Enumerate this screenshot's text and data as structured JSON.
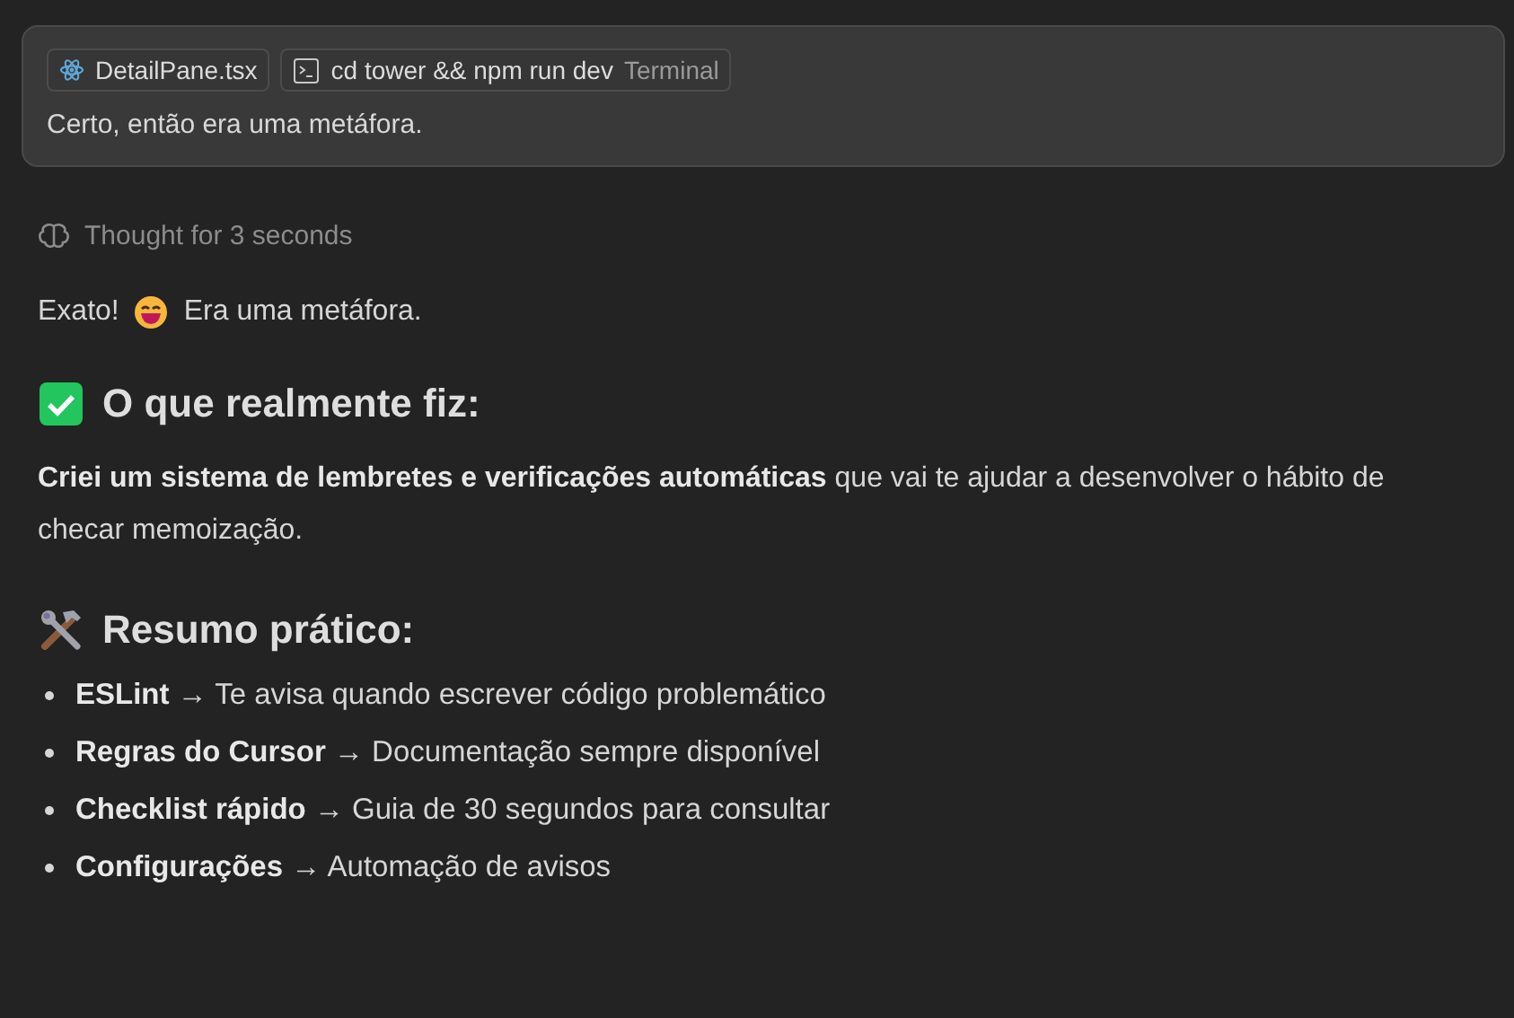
{
  "prompt_card": {
    "chips": [
      {
        "kind": "file",
        "label": "DetailPane.tsx"
      },
      {
        "kind": "terminal",
        "label": "cd tower && npm run dev",
        "suffix": "Terminal"
      }
    ],
    "message": "Certo, então era uma metáfora."
  },
  "thought": "Thought for 3 seconds",
  "response": [
    {
      "kind": "paragraph",
      "before": "Exato!",
      "after": "Era uma metáfora."
    },
    {
      "kind": "heading",
      "text": "O que realmente fiz:"
    },
    {
      "kind": "rich",
      "text": "**Criei um sistema de lembretes e verificações automáticas** que vai te ajudar a desenvolver o hábito de checar memoização."
    },
    {
      "kind": "heading",
      "text": "Resumo prático:"
    },
    {
      "kind": "bullets",
      "items": [
        "**ESLint** → Te avisa quando escrever código problemático",
        "**Regras do Cursor** → Documentação sempre disponível",
        "**Checklist rápido** → Guia de 30 segundos para consultar",
        "**Configurações** → Automação de avisos"
      ]
    }
  ]
}
